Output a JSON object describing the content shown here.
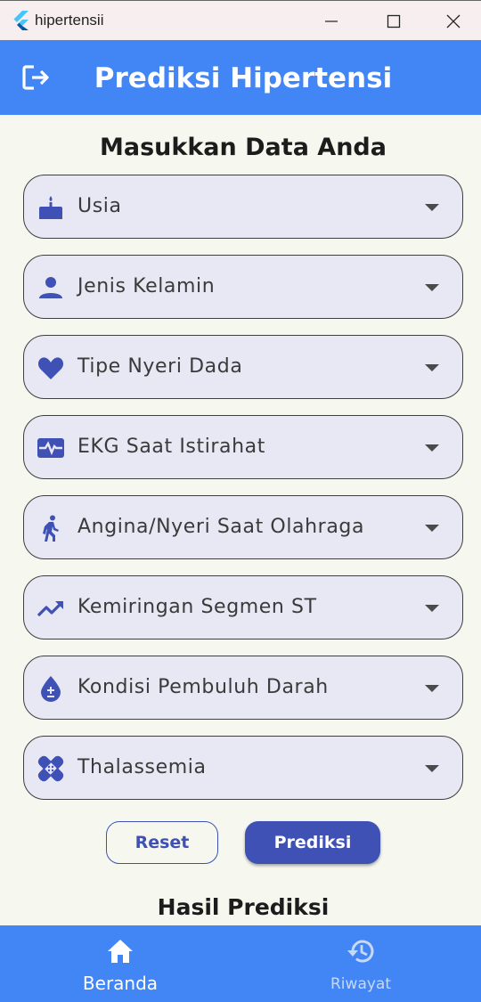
{
  "window": {
    "title": "hipertensii"
  },
  "appbar": {
    "title": "Prediksi Hipertensi",
    "logout_icon": "logout-icon"
  },
  "form": {
    "heading": "Masukkan Data Anda",
    "fields": [
      {
        "label": "Usia",
        "icon": "cake-icon"
      },
      {
        "label": "Jenis Kelamin",
        "icon": "person-icon"
      },
      {
        "label": "Tipe Nyeri Dada",
        "icon": "heart-icon"
      },
      {
        "label": "EKG Saat Istirahat",
        "icon": "monitor-heart-icon"
      },
      {
        "label": "Angina/Nyeri Saat Olahraga",
        "icon": "walking-icon"
      },
      {
        "label": "Kemiringan Segmen ST",
        "icon": "trending-up-icon"
      },
      {
        "label": "Kondisi Pembuluh Darah",
        "icon": "blood-drop-icon"
      },
      {
        "label": "Thalassemia",
        "icon": "bandage-icon"
      }
    ]
  },
  "buttons": {
    "reset": "Reset",
    "predict": "Prediksi"
  },
  "result": {
    "heading": "Hasil Prediksi"
  },
  "bottom_nav": {
    "items": [
      {
        "label": "Beranda",
        "icon": "home-icon",
        "active": true
      },
      {
        "label": "Riwayat",
        "icon": "history-icon",
        "active": false
      }
    ]
  },
  "colors": {
    "appbar": "#4285f4",
    "accent": "#3f51b5",
    "field_bg": "#e7e8f4",
    "page_bg": "#f6f8f0"
  }
}
